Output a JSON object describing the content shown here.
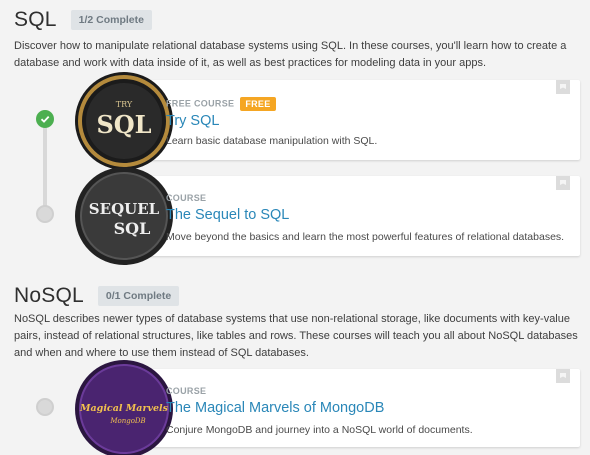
{
  "sections": [
    {
      "title": "SQL",
      "progress": "1/2 Complete",
      "description": "Discover how to manipulate relational database systems using SQL. In these courses, you'll learn how to create a database and work with data inside of it, as well as best practices for modeling data in your apps.",
      "courses": [
        {
          "kind": "FREE COURSE",
          "tag": "FREE",
          "title": "Try SQL",
          "description": "Learn basic database manipulation with SQL.",
          "badge_text": "SQL",
          "badge_sub": "TRY",
          "completed": true
        },
        {
          "kind": "COURSE",
          "title": "The Sequel to SQL",
          "description": "Move beyond the basics and learn the most powerful features of relational databases.",
          "badge_text": "SEQUEL",
          "badge_sub": "SQL",
          "completed": false
        }
      ]
    },
    {
      "title": "NoSQL",
      "progress": "0/1 Complete",
      "description": "NoSQL describes newer types of database systems that use non-relational storage, like documents with key-value pairs, instead of relational structures, like tables and rows. These courses will teach you all about NoSQL databases and when and where to use them instead of SQL databases.",
      "courses": [
        {
          "kind": "COURSE",
          "title": "The Magical Marvels of MongoDB",
          "description": "Conjure MongoDB and journey into a NoSQL world of documents.",
          "badge_text": "Magical Marvels",
          "badge_sub": "MongoDB",
          "completed": false
        }
      ]
    }
  ],
  "colors": {
    "link": "#2a87b8",
    "free_tag": "#f5a623",
    "complete": "#4caf50"
  }
}
